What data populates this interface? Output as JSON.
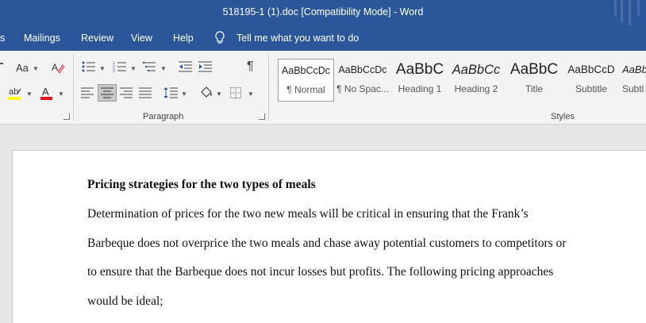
{
  "window": {
    "title": "518195-1 (1).doc [Compatibility Mode]  -  Word"
  },
  "menu": {
    "items": [
      "s",
      "Mailings",
      "Review",
      "View",
      "Help"
    ],
    "tell_me": "Tell me what you want to do"
  },
  "ribbon": {
    "font_group": {
      "change_case_label": "Aa"
    },
    "paragraph_group": {
      "label": "Paragraph"
    },
    "styles_group": {
      "label": "Styles",
      "styles": [
        {
          "preview": "AaBbCcDc",
          "name": "¶ Normal",
          "selected": true
        },
        {
          "preview": "AaBbCcDc",
          "name": "¶ No Spac..."
        },
        {
          "preview": "AaBbC",
          "name": "Heading 1"
        },
        {
          "preview": "AaBbCc",
          "name": "Heading 2"
        },
        {
          "preview": "AaBbC",
          "name": "Title"
        },
        {
          "preview": "AaBbCcD",
          "name": "Subtitle"
        },
        {
          "preview": "AaBbC",
          "name": "Subtl"
        }
      ]
    }
  },
  "document": {
    "heading": "Pricing strategies for the two types of meals",
    "lines": [
      "Determination of prices for the two new meals will be critical in ensuring that the Frank’s",
      "Barbeque does not overprice the two meals and chase away potential customers to competitors or",
      "to ensure that the Barbeque does not incur losses but profits. The following pricing approaches",
      "would be ideal;"
    ]
  },
  "colors": {
    "titlebar": "#2b579a",
    "ribbon": "#f3f3f3",
    "canvas": "#e6e6e6",
    "font_color_bar": "#e81123",
    "highlight_bar": "#ffff00"
  }
}
